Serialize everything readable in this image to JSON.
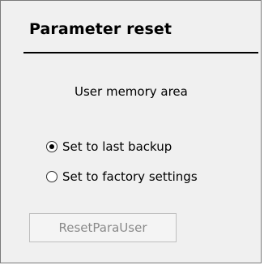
{
  "panel": {
    "title": "Parameter reset",
    "section_label": "User memory area",
    "options": [
      {
        "label": "Set to last backup",
        "selected": true
      },
      {
        "label": "Set to factory settings",
        "selected": false
      }
    ],
    "reset_button_label": "ResetParaUser",
    "reset_button_enabled": false
  }
}
